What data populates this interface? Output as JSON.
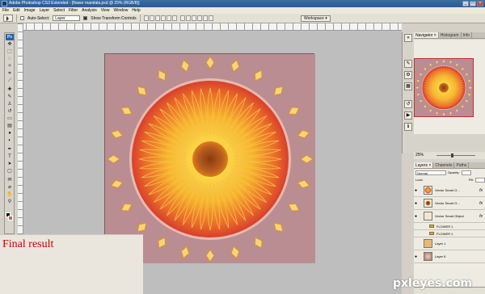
{
  "window": {
    "title": "Adobe Photoshop CS3 Extended - [flower mandala.psd @ 25% (RGB/8)]",
    "controls": [
      "_",
      "□",
      "×"
    ]
  },
  "menu": [
    "File",
    "Edit",
    "Image",
    "Layer",
    "Select",
    "Filter",
    "Analysis",
    "View",
    "Window",
    "Help"
  ],
  "options": {
    "auto_select_label": "Auto-Select:",
    "auto_select_value": "Layer",
    "show_transform_label": "Show Transform Controls",
    "workspace_label": "Workspace ▾"
  },
  "toolbox": {
    "logo": "Ps",
    "foreground_color": "#000000",
    "background_color": "#b07070"
  },
  "document": {
    "background_color": "#ba8d92",
    "petal_color": "#f4c14a",
    "ring_color": "#d9432c",
    "center_color": "#b8601e"
  },
  "caption": {
    "text": "Final result",
    "color": "#cc0000"
  },
  "panels": {
    "navigator_tabs": [
      "Navigator ×",
      "Histogram",
      "Info"
    ],
    "zoom": "25%",
    "layers_tabs": [
      "Layers ×",
      "Channels",
      "Paths"
    ],
    "blend_mode": "Normal",
    "opacity_label": "Opacity:",
    "fill_label": "Fill:",
    "lock_label": "Lock:",
    "layers": [
      {
        "name": "Vector Smart O...",
        "type": "smart",
        "fx": "fx"
      },
      {
        "name": "Vector Smart O...",
        "type": "smart",
        "fx": "fx"
      },
      {
        "name": "Vector Smart Object",
        "type": "smart",
        "fx": "fx"
      },
      {
        "name": "FLOWER 1",
        "type": "group",
        "fx": ""
      },
      {
        "name": "FLOWER 1",
        "type": "group",
        "fx": ""
      },
      {
        "name": "Layer 1",
        "type": "layer",
        "fx": ""
      },
      {
        "name": "Layer 5",
        "type": "layer",
        "fx": ""
      }
    ]
  },
  "watermark": "pxleyes.com"
}
